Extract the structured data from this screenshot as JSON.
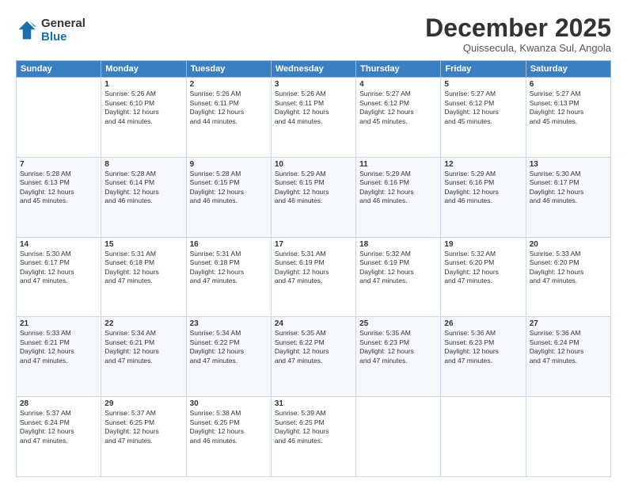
{
  "logo": {
    "general": "General",
    "blue": "Blue"
  },
  "header": {
    "month": "December 2025",
    "location": "Quissecula, Kwanza Sul, Angola"
  },
  "weekdays": [
    "Sunday",
    "Monday",
    "Tuesday",
    "Wednesday",
    "Thursday",
    "Friday",
    "Saturday"
  ],
  "weeks": [
    [
      {
        "day": "",
        "info": ""
      },
      {
        "day": "1",
        "info": "Sunrise: 5:26 AM\nSunset: 6:10 PM\nDaylight: 12 hours\nand 44 minutes."
      },
      {
        "day": "2",
        "info": "Sunrise: 5:26 AM\nSunset: 6:11 PM\nDaylight: 12 hours\nand 44 minutes."
      },
      {
        "day": "3",
        "info": "Sunrise: 5:26 AM\nSunset: 6:11 PM\nDaylight: 12 hours\nand 44 minutes."
      },
      {
        "day": "4",
        "info": "Sunrise: 5:27 AM\nSunset: 6:12 PM\nDaylight: 12 hours\nand 45 minutes."
      },
      {
        "day": "5",
        "info": "Sunrise: 5:27 AM\nSunset: 6:12 PM\nDaylight: 12 hours\nand 45 minutes."
      },
      {
        "day": "6",
        "info": "Sunrise: 5:27 AM\nSunset: 6:13 PM\nDaylight: 12 hours\nand 45 minutes."
      }
    ],
    [
      {
        "day": "7",
        "info": "Sunrise: 5:28 AM\nSunset: 6:13 PM\nDaylight: 12 hours\nand 45 minutes."
      },
      {
        "day": "8",
        "info": "Sunrise: 5:28 AM\nSunset: 6:14 PM\nDaylight: 12 hours\nand 46 minutes."
      },
      {
        "day": "9",
        "info": "Sunrise: 5:28 AM\nSunset: 6:15 PM\nDaylight: 12 hours\nand 46 minutes."
      },
      {
        "day": "10",
        "info": "Sunrise: 5:29 AM\nSunset: 6:15 PM\nDaylight: 12 hours\nand 46 minutes."
      },
      {
        "day": "11",
        "info": "Sunrise: 5:29 AM\nSunset: 6:16 PM\nDaylight: 12 hours\nand 46 minutes."
      },
      {
        "day": "12",
        "info": "Sunrise: 5:29 AM\nSunset: 6:16 PM\nDaylight: 12 hours\nand 46 minutes."
      },
      {
        "day": "13",
        "info": "Sunrise: 5:30 AM\nSunset: 6:17 PM\nDaylight: 12 hours\nand 46 minutes."
      }
    ],
    [
      {
        "day": "14",
        "info": "Sunrise: 5:30 AM\nSunset: 6:17 PM\nDaylight: 12 hours\nand 47 minutes."
      },
      {
        "day": "15",
        "info": "Sunrise: 5:31 AM\nSunset: 6:18 PM\nDaylight: 12 hours\nand 47 minutes."
      },
      {
        "day": "16",
        "info": "Sunrise: 5:31 AM\nSunset: 6:18 PM\nDaylight: 12 hours\nand 47 minutes."
      },
      {
        "day": "17",
        "info": "Sunrise: 5:31 AM\nSunset: 6:19 PM\nDaylight: 12 hours\nand 47 minutes."
      },
      {
        "day": "18",
        "info": "Sunrise: 5:32 AM\nSunset: 6:19 PM\nDaylight: 12 hours\nand 47 minutes."
      },
      {
        "day": "19",
        "info": "Sunrise: 5:32 AM\nSunset: 6:20 PM\nDaylight: 12 hours\nand 47 minutes."
      },
      {
        "day": "20",
        "info": "Sunrise: 5:33 AM\nSunset: 6:20 PM\nDaylight: 12 hours\nand 47 minutes."
      }
    ],
    [
      {
        "day": "21",
        "info": "Sunrise: 5:33 AM\nSunset: 6:21 PM\nDaylight: 12 hours\nand 47 minutes."
      },
      {
        "day": "22",
        "info": "Sunrise: 5:34 AM\nSunset: 6:21 PM\nDaylight: 12 hours\nand 47 minutes."
      },
      {
        "day": "23",
        "info": "Sunrise: 5:34 AM\nSunset: 6:22 PM\nDaylight: 12 hours\nand 47 minutes."
      },
      {
        "day": "24",
        "info": "Sunrise: 5:35 AM\nSunset: 6:22 PM\nDaylight: 12 hours\nand 47 minutes."
      },
      {
        "day": "25",
        "info": "Sunrise: 5:35 AM\nSunset: 6:23 PM\nDaylight: 12 hours\nand 47 minutes."
      },
      {
        "day": "26",
        "info": "Sunrise: 5:36 AM\nSunset: 6:23 PM\nDaylight: 12 hours\nand 47 minutes."
      },
      {
        "day": "27",
        "info": "Sunrise: 5:36 AM\nSunset: 6:24 PM\nDaylight: 12 hours\nand 47 minutes."
      }
    ],
    [
      {
        "day": "28",
        "info": "Sunrise: 5:37 AM\nSunset: 6:24 PM\nDaylight: 12 hours\nand 47 minutes."
      },
      {
        "day": "29",
        "info": "Sunrise: 5:37 AM\nSunset: 6:25 PM\nDaylight: 12 hours\nand 47 minutes."
      },
      {
        "day": "30",
        "info": "Sunrise: 5:38 AM\nSunset: 6:25 PM\nDaylight: 12 hours\nand 46 minutes."
      },
      {
        "day": "31",
        "info": "Sunrise: 5:39 AM\nSunset: 6:25 PM\nDaylight: 12 hours\nand 46 minutes."
      },
      {
        "day": "",
        "info": ""
      },
      {
        "day": "",
        "info": ""
      },
      {
        "day": "",
        "info": ""
      }
    ]
  ]
}
